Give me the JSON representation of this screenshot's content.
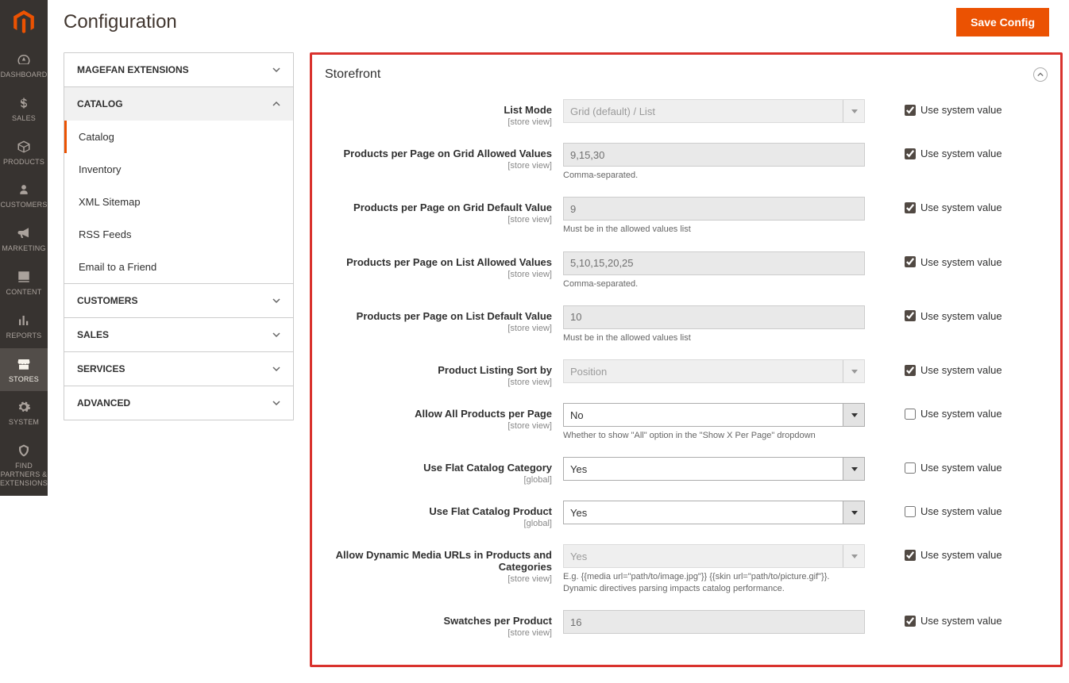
{
  "page": {
    "title": "Configuration",
    "save_btn": "Save Config"
  },
  "admin_menu": [
    {
      "key": "dashboard",
      "label": "DASHBOARD"
    },
    {
      "key": "sales",
      "label": "SALES"
    },
    {
      "key": "products",
      "label": "PRODUCTS"
    },
    {
      "key": "customers",
      "label": "CUSTOMERS"
    },
    {
      "key": "marketing",
      "label": "MARKETING"
    },
    {
      "key": "content",
      "label": "CONTENT"
    },
    {
      "key": "reports",
      "label": "REPORTS"
    },
    {
      "key": "stores",
      "label": "STORES"
    },
    {
      "key": "system",
      "label": "SYSTEM"
    },
    {
      "key": "partners",
      "label": "FIND PARTNERS & EXTENSIONS"
    }
  ],
  "config_nav": [
    {
      "label": "MAGEFAN EXTENSIONS",
      "open": false
    },
    {
      "label": "CATALOG",
      "open": true,
      "items": [
        {
          "label": "Catalog",
          "active": true
        },
        {
          "label": "Inventory"
        },
        {
          "label": "XML Sitemap"
        },
        {
          "label": "RSS Feeds"
        },
        {
          "label": "Email to a Friend"
        }
      ]
    },
    {
      "label": "CUSTOMERS",
      "open": false
    },
    {
      "label": "SALES",
      "open": false
    },
    {
      "label": "SERVICES",
      "open": false
    },
    {
      "label": "ADVANCED",
      "open": false
    }
  ],
  "fieldset": {
    "title": "Storefront"
  },
  "sys_value_label": "Use system value",
  "fields": {
    "list_mode": {
      "label": "List Mode",
      "scope": "[store view]",
      "value": "Grid (default) / List",
      "type": "select",
      "use_system": true
    },
    "grid_allowed": {
      "label": "Products per Page on Grid Allowed Values",
      "scope": "[store view]",
      "value": "9,15,30",
      "type": "text",
      "note": "Comma-separated.",
      "use_system": true
    },
    "grid_default": {
      "label": "Products per Page on Grid Default Value",
      "scope": "[store view]",
      "value": "9",
      "type": "text",
      "note": "Must be in the allowed values list",
      "use_system": true
    },
    "list_allowed": {
      "label": "Products per Page on List Allowed Values",
      "scope": "[store view]",
      "value": "5,10,15,20,25",
      "type": "text",
      "note": "Comma-separated.",
      "use_system": true
    },
    "list_default": {
      "label": "Products per Page on List Default Value",
      "scope": "[store view]",
      "value": "10",
      "type": "text",
      "note": "Must be in the allowed values list",
      "use_system": true
    },
    "sort_by": {
      "label": "Product Listing Sort by",
      "scope": "[store view]",
      "value": "Position",
      "type": "select",
      "use_system": true
    },
    "allow_all": {
      "label": "Allow All Products per Page",
      "scope": "[store view]",
      "value": "No",
      "type": "select",
      "note": "Whether to show \"All\" option in the \"Show X Per Page\" dropdown",
      "use_system": false,
      "enabled": true
    },
    "flat_category": {
      "label": "Use Flat Catalog Category",
      "scope": "[global]",
      "value": "Yes",
      "type": "select",
      "use_system": false,
      "enabled": true
    },
    "flat_product": {
      "label": "Use Flat Catalog Product",
      "scope": "[global]",
      "value": "Yes",
      "type": "select",
      "use_system": false,
      "enabled": true
    },
    "dynamic_media": {
      "label": "Allow Dynamic Media URLs in Products and Categories",
      "scope": "[store view]",
      "value": "Yes",
      "type": "select",
      "note": "E.g. {{media url=\"path/to/image.jpg\"}} {{skin url=\"path/to/picture.gif\"}}. Dynamic directives parsing impacts catalog performance.",
      "use_system": true
    },
    "swatches": {
      "label": "Swatches per Product",
      "scope": "[store view]",
      "value": "16",
      "type": "text",
      "use_system": true
    }
  }
}
